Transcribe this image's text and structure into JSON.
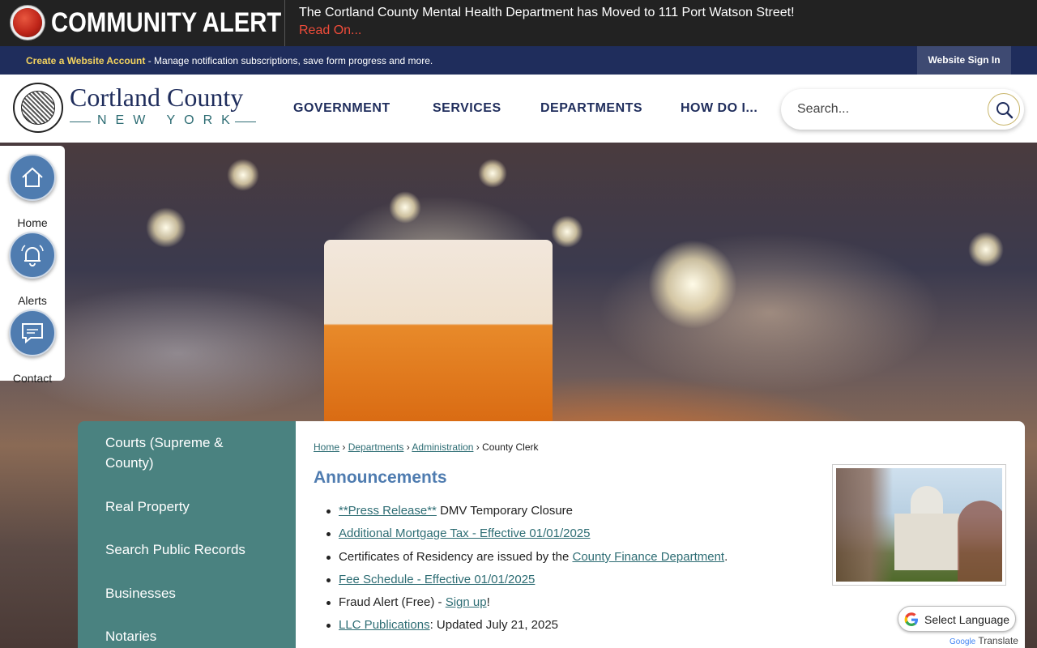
{
  "alert": {
    "title": "COMMUNITY ALERT",
    "message": "The Cortland County Mental Health Department has Moved to 111 Port Watson Street!",
    "read_on": "Read On..."
  },
  "account_bar": {
    "create_link": "Create a Website Account",
    "description": " - Manage notification subscriptions, save form progress and more.",
    "sign_in": "Website Sign In"
  },
  "header": {
    "logo_main": "Cortland County",
    "logo_sub": "NEW YORK",
    "nav": [
      "GOVERNMENT",
      "SERVICES",
      "DEPARTMENTS",
      "HOW DO I..."
    ],
    "search_placeholder": "Search..."
  },
  "quick_links": [
    {
      "label": "Home",
      "icon": "home-icon"
    },
    {
      "label": "Alerts",
      "icon": "bell-icon"
    },
    {
      "label": "Contact",
      "icon": "chat-icon"
    }
  ],
  "left_nav": [
    "Courts (Supreme & County)",
    "Real Property",
    "Search Public Records",
    "Businesses",
    "Notaries"
  ],
  "breadcrumb": {
    "home": "Home",
    "departments": "Departments",
    "administration": "Administration",
    "current": "County Clerk",
    "sep": "›"
  },
  "announcements": {
    "title": "Announcements",
    "items": [
      {
        "link": "**Press Release**",
        "text": " DMV Temporary Closure"
      },
      {
        "link": "Additional Mortgage Tax - Effective 01/01/2025",
        "text": ""
      },
      {
        "pre": "Certificates of Residency are issued by the ",
        "link": "County Finance Department",
        "text": "."
      },
      {
        "link": "Fee Schedule - Effective 01/01/2025",
        "text": ""
      },
      {
        "pre": "Fraud Alert (Free) - ",
        "link": "Sign up",
        "text": "!"
      },
      {
        "link": "LLC Publications",
        "text": ": Updated July 21, 2025"
      }
    ]
  },
  "translate": {
    "label": "Select Language",
    "powered_by": "Google",
    "translate_word": "Translate"
  },
  "colors": {
    "alert_bg": "#222222",
    "account_bg": "#1f2d5c",
    "brand_navy": "#1f2d5c",
    "teal": "#4a8280",
    "link_teal": "#2e6d74",
    "heading_blue": "#4f7cb0",
    "alert_red": "#f04c3a"
  }
}
